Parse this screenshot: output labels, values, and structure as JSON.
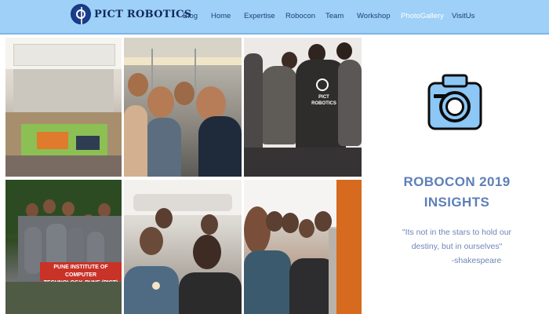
{
  "brand": {
    "name": "PICT ROBOTICS",
    "logo_icon": "pict-robotics-logo-icon"
  },
  "nav": {
    "items": [
      {
        "label": "Blog",
        "active": false
      },
      {
        "label": "Home",
        "active": false
      },
      {
        "label": "Expertise",
        "active": false
      },
      {
        "label": "Robocon",
        "active": false
      },
      {
        "label": "Team",
        "active": false
      },
      {
        "label": "Workshop",
        "active": false
      },
      {
        "label": "PhotoGallery",
        "active": true
      },
      {
        "label": "VisitUs",
        "active": false
      }
    ]
  },
  "gallery": {
    "photos": [
      {
        "id": "p1",
        "depicts": "event-hall-robot-arena"
      },
      {
        "id": "p2",
        "depicts": "team-selfie-train"
      },
      {
        "id": "p3",
        "depicts": "team-backs-tshirts"
      },
      {
        "id": "p4",
        "depicts": "team-banner-group"
      },
      {
        "id": "p5",
        "depicts": "metro-selfie"
      },
      {
        "id": "p6",
        "depicts": "metro-group-selfie"
      }
    ],
    "banner_text": "PUNE INSTITUTE OF COMPUTER\nTECHNOLOGY, PUNE (PICT)",
    "tshirt_text": "PICT\nROBOTICS"
  },
  "side": {
    "icon": "camera-icon",
    "headline_lines": [
      "ROBOCON 2019",
      "INSIGHTS"
    ],
    "quote_lines": [
      "\"Its not in the stars to hold our",
      "destiny, but in ourselves\"",
      "-shakespeare"
    ]
  },
  "colors": {
    "navbar": "#9fd0f7",
    "nav_text": "#1f3f7a",
    "nav_active": "#ffffff",
    "accent": "#5d7fb8",
    "camera_fill": "#8cc7f5"
  }
}
